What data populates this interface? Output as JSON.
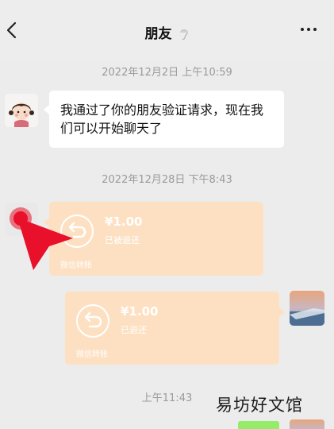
{
  "header": {
    "back_icon": "chevron-left-icon",
    "title": "朋友",
    "title_icon": "ear-icon",
    "more_icon": "more-dots-icon"
  },
  "messages": {
    "timestamp_1": "2022年12月2日 上午10:59",
    "greeting_text": "我通过了你的朋友验证请求，现在我们可以开始聊天了",
    "timestamp_2": "2022年12月28日 下午8:43",
    "transfer_1": {
      "amount": "¥1.00",
      "status": "已被退还",
      "footer": "微信转账"
    },
    "transfer_2": {
      "amount": "¥1.00",
      "status": "已退还",
      "footer": "微信转账"
    },
    "timestamp_3": "上午11:43"
  },
  "watermark": "易坊好文馆",
  "colors": {
    "background": "#ececec",
    "transfer_bubble": "#fde0c2",
    "text_bubble": "#ffffff",
    "annotation_red": "#e8102a",
    "self_bubble": "#95ec69"
  }
}
